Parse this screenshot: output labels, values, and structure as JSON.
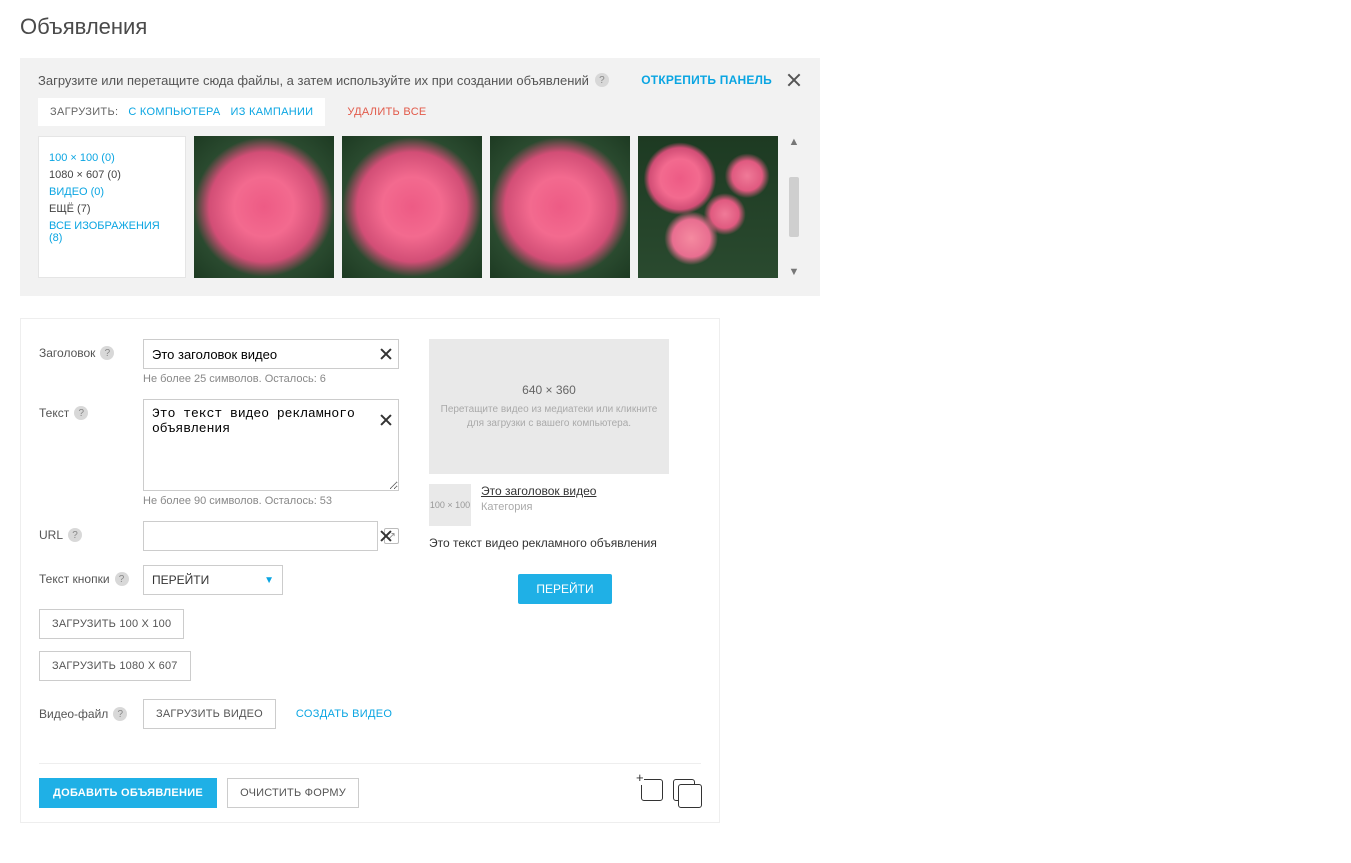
{
  "page_title": "Объявления",
  "upload_panel": {
    "instruction": "Загрузите или перетащите сюда файлы, а затем используйте их при создании объявлений",
    "unpin_label": "ОТКРЕПИТЬ ПАНЕЛЬ",
    "load_label": "ЗАГРУЗИТЬ:",
    "from_computer": "С КОМПЬЮТЕРА",
    "from_campaign": "ИЗ КАМПАНИИ",
    "delete_all": "УДАЛИТЬ ВСЕ",
    "filters": {
      "f100": "100 × 100 (0)",
      "f1080": "1080 × 607 (0)",
      "video": "ВИДЕО (0)",
      "more": "ЕЩЁ (7)",
      "all": "ВСЕ ИЗОБРАЖЕНИЯ (8)"
    }
  },
  "form": {
    "labels": {
      "title": "Заголовок",
      "text": "Текст",
      "url": "URL",
      "button_text": "Текст кнопки",
      "video_file": "Видео-файл"
    },
    "title_value": "Это заголовок видео",
    "title_hint": "Не более 25 символов. Осталось: 6",
    "text_value": "Это текст видео рекламного объявления",
    "text_hint": "Не более 90 символов. Осталось: 53",
    "url_value": "",
    "button_select": "ПЕРЕЙТИ",
    "btn_100": "ЗАГРУЗИТЬ 100 Х 100",
    "btn_1080": "ЗАГРУЗИТЬ 1080 Х 607",
    "btn_video": "ЗАГРУЗИТЬ ВИДЕО",
    "link_create_video": "СОЗДАТЬ ВИДЕО"
  },
  "preview": {
    "dim": "640 × 360",
    "drop_msg": "Перетащите видео из медиатеки или кликните для загрузки с вашего компьютера.",
    "thumb_label": "100 × 100",
    "title": "Это заголовок видео",
    "category": "Категория",
    "text": "Это текст видео рекламного объявления",
    "cta": "ПЕРЕЙТИ"
  },
  "footer": {
    "add": "ДОБАВИТЬ ОБЪЯВЛЕНИЕ",
    "clear": "ОЧИСТИТЬ ФОРМУ"
  }
}
